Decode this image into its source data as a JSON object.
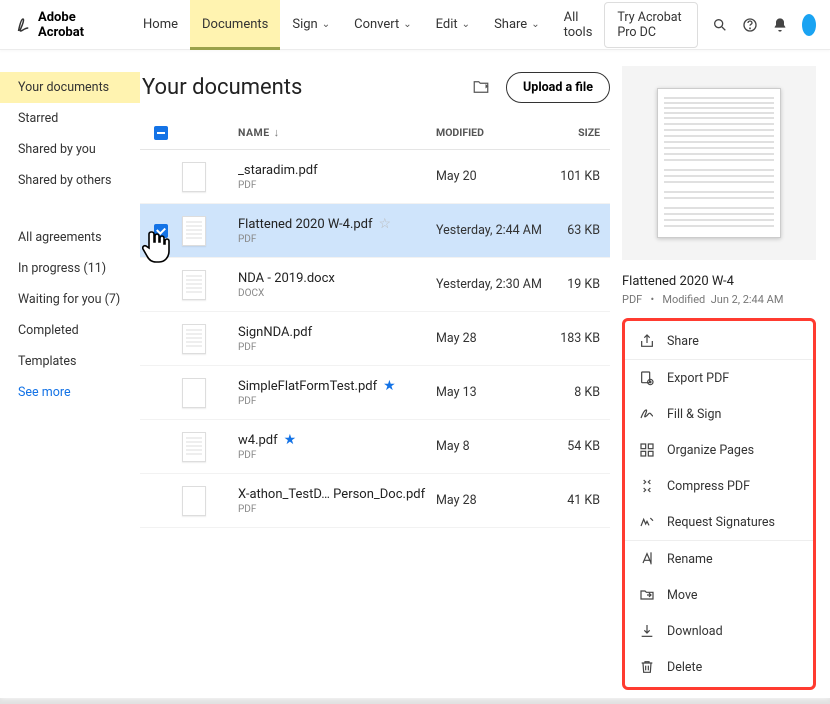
{
  "brand": "Adobe Acrobat",
  "nav": {
    "home": "Home",
    "documents": "Documents",
    "sign": "Sign",
    "convert": "Convert",
    "edit": "Edit",
    "share": "Share",
    "alltools": "All tools"
  },
  "header": {
    "try": "Try Acrobat Pro DC"
  },
  "sidebar": {
    "items": [
      "Your documents",
      "Starred",
      "Shared by you",
      "Shared by others"
    ],
    "items2": [
      "All agreements",
      "In progress (11)",
      "Waiting for you (7)",
      "Completed",
      "Templates"
    ],
    "seemore": "See more"
  },
  "title": "Your documents",
  "upload": "Upload a file",
  "columns": {
    "name": "NAME",
    "modified": "MODIFIED",
    "size": "SIZE"
  },
  "files": [
    {
      "name": "_staradim.pdf",
      "type": "PDF",
      "modified": "May 20",
      "size": "101 KB",
      "star": "",
      "selected": false,
      "lines": false
    },
    {
      "name": "Flattened 2020 W-4.pdf",
      "type": "PDF",
      "modified": "Yesterday, 2:44 AM",
      "size": "63 KB",
      "star": "☆",
      "selected": true,
      "lines": true
    },
    {
      "name": "NDA - 2019.docx",
      "type": "DOCX",
      "modified": "Yesterday, 2:30 AM",
      "size": "19 KB",
      "star": "",
      "selected": false,
      "lines": true
    },
    {
      "name": "SignNDA.pdf",
      "type": "PDF",
      "modified": "May 28",
      "size": "183 KB",
      "star": "",
      "selected": false,
      "lines": true
    },
    {
      "name": "SimpleFlatFormTest.pdf",
      "type": "PDF",
      "modified": "May 13",
      "size": "8 KB",
      "star": "★",
      "selected": false,
      "lines": false
    },
    {
      "name": "w4.pdf",
      "type": "PDF",
      "modified": "May 8",
      "size": "54 KB",
      "star": "★",
      "selected": false,
      "lines": true
    },
    {
      "name": "X-athon_TestD… Person_Doc.pdf",
      "type": "PDF",
      "modified": "May 28",
      "size": "41 KB",
      "star": "",
      "selected": false,
      "lines": false
    }
  ],
  "detail": {
    "title": "Flattened 2020 W-4",
    "meta_type": "PDF",
    "meta_sep": "•",
    "meta_mod_label": "Modified",
    "meta_mod_value": "Jun 2, 2:44 AM"
  },
  "actions": {
    "share": "Share",
    "export": "Export PDF",
    "fillsign": "Fill & Sign",
    "organize": "Organize Pages",
    "compress": "Compress PDF",
    "request": "Request Signatures",
    "rename": "Rename",
    "move": "Move",
    "download": "Download",
    "delete": "Delete"
  }
}
